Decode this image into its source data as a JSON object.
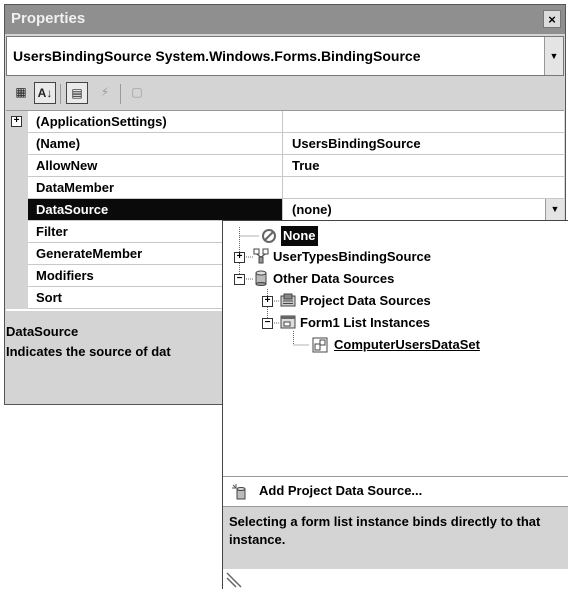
{
  "window": {
    "title": "Properties",
    "close_glyph": "×"
  },
  "object_selector": {
    "name": "UsersBindingSource",
    "type": "System.Windows.Forms.BindingSource",
    "dropdown_glyph": "▼"
  },
  "toolbar": {
    "buttons": [
      {
        "icon": "categorized-icon",
        "glyph": "▦",
        "state": "off-normal"
      },
      {
        "icon": "alphabetical-icon",
        "glyph": "A↓",
        "state": "pressed"
      },
      {
        "icon": "properties-icon",
        "glyph": "▤",
        "state": "pressed"
      },
      {
        "icon": "events-lightning-icon",
        "glyph": "⚡",
        "state": "disabled"
      },
      {
        "icon": "property-pages-icon",
        "glyph": "▢",
        "state": "disabled"
      }
    ]
  },
  "grid": {
    "rows": [
      {
        "name": "(ApplicationSettings)",
        "value": "",
        "expander": "+"
      },
      {
        "name": "(Name)",
        "value": "UsersBindingSource"
      },
      {
        "name": "AllowNew",
        "value": "True"
      },
      {
        "name": "DataMember",
        "value": ""
      },
      {
        "name": "DataSource",
        "value": "(none)",
        "selected": true
      },
      {
        "name": "Filter",
        "value": ""
      },
      {
        "name": "GenerateMember",
        "value": ""
      },
      {
        "name": "Modifiers",
        "value": ""
      },
      {
        "name": "Sort",
        "value": ""
      }
    ]
  },
  "description": {
    "title": "DataSource",
    "text": "Indicates the source of dat"
  },
  "popup": {
    "tree": {
      "none": "None",
      "user_types": "UserTypesBindingSource",
      "other": "Other Data Sources",
      "project": "Project Data Sources",
      "form1": "Form1 List Instances",
      "dataset": "ComputerUsersDataSet"
    },
    "add_link": "Add Project Data Source...",
    "help_text": "Selecting a form list instance binds directly to that instance."
  },
  "colors": {
    "title_bar": "#8f8f8f",
    "panel": "#d4d4d4",
    "selection": "#0a0a0a"
  }
}
